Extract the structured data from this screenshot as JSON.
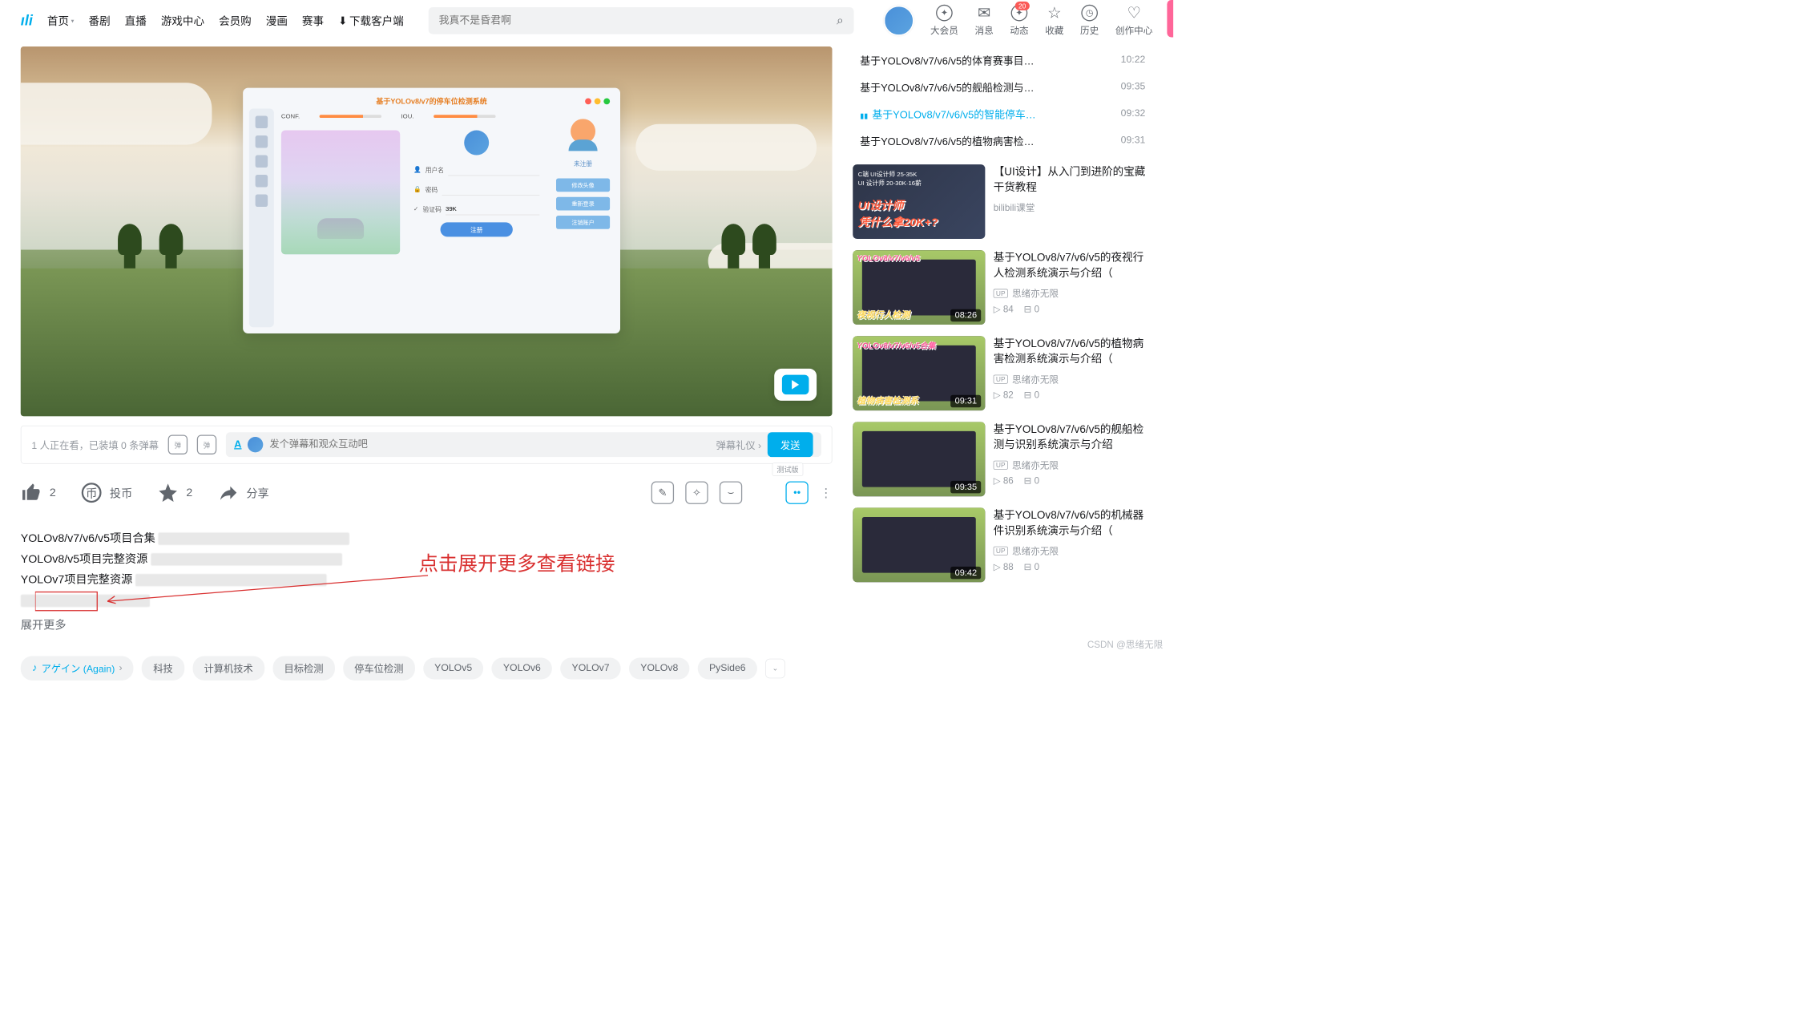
{
  "header": {
    "nav": [
      "首页",
      "番剧",
      "直播",
      "游戏中心",
      "会员购",
      "漫画",
      "赛事"
    ],
    "download": "下载客户端",
    "search_placeholder": "我真不是昏君啊",
    "usermenu": [
      {
        "label": "大会员"
      },
      {
        "label": "消息"
      },
      {
        "label": "动态",
        "badge": "20"
      },
      {
        "label": "收藏"
      },
      {
        "label": "历史"
      },
      {
        "label": "创作中心"
      }
    ]
  },
  "appwin": {
    "title": "基于YOLOv8/v7的停车位检测系统",
    "conf": "CONF.",
    "iou": "IOU.",
    "user": "用户名",
    "pass": "密码",
    "code": "验证码",
    "code_val": "39K",
    "btn": "注册",
    "menu": "未注册",
    "sidebtns": [
      "修改头像",
      "重新登录",
      "注销账户"
    ]
  },
  "danbar": {
    "watching": "1 人正在看，已装填 0 条弹幕",
    "placeholder": "发个弹幕和观众互动吧",
    "etiquette": "弹幕礼仪",
    "send": "发送"
  },
  "actions": {
    "like": "2",
    "coin": "投币",
    "fav": "2",
    "share": "分享",
    "test": "测试版"
  },
  "desc": {
    "lines": [
      "YOLOv8/v7/v6/v5项目合集",
      "YOLOv8/v5项目完整资源",
      "YOLOv7项目完整资源"
    ],
    "expand": "展开更多",
    "callout": "点击展开更多查看链接"
  },
  "tags": {
    "music": "アゲイン (Again)",
    "list": [
      "科技",
      "计算机技术",
      "目标检测",
      "停车位检测",
      "YOLOv5",
      "YOLOv6",
      "YOLOv7",
      "YOLOv8",
      "PySide6"
    ]
  },
  "playlist": [
    {
      "title": "基于YOLOv8/v7/v6/v5的体育赛事目…",
      "time": "10:22"
    },
    {
      "title": "基于YOLOv8/v7/v6/v5的舰船检测与…",
      "time": "09:35"
    },
    {
      "title": "基于YOLOv8/v7/v6/v5的智能停车…",
      "time": "09:32",
      "active": true
    },
    {
      "title": "基于YOLOv8/v7/v6/v5的植物病害检…",
      "time": "09:31"
    }
  ],
  "recs": [
    {
      "title": "【UI设计】从入门到进阶的宝藏干货教程",
      "up": "bilibili课堂",
      "promo": true,
      "promo_lines": [
        "C端 UI设计师 25-35K",
        "UI 设计师 20-30K·16薪"
      ],
      "promo_big1": "UI设计师",
      "promo_big2": "凭什么拿20K+?"
    },
    {
      "title": "基于YOLOv8/v7/v6/v5的夜视行人检测系统演示与介绍（",
      "up": "思绪亦无限",
      "views": "84",
      "dm": "0",
      "dur": "08:26",
      "cap": "夜视行人检测",
      "tlab": "YOLOv8/v7/v6/v5"
    },
    {
      "title": "基于YOLOv8/v7/v6/v5的植物病害检测系统演示与介绍（",
      "up": "思绪亦无限",
      "views": "82",
      "dm": "0",
      "dur": "09:31",
      "cap": "植物病害检测系",
      "tlab": "YOLOv8/v7/v6/v5合集"
    },
    {
      "title": "基于YOLOv8/v7/v6/v5的舰船检测与识别系统演示与介绍",
      "up": "思绪亦无限",
      "views": "86",
      "dm": "0",
      "dur": "09:35"
    },
    {
      "title": "基于YOLOv8/v7/v6/v5的机械器件识别系统演示与介绍（",
      "up": "思绪亦无限",
      "views": "88",
      "dm": "0",
      "dur": "09:42"
    }
  ],
  "watermark": "CSDN @思绪无限"
}
